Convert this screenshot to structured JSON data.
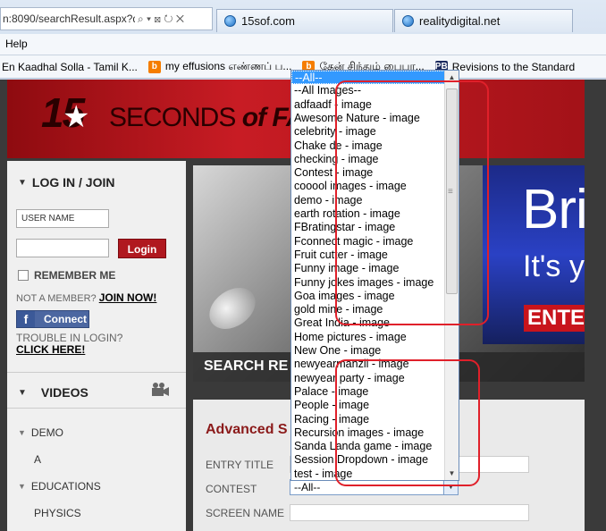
{
  "browser": {
    "address_url": "n:8090/searchResult.aspx?qu",
    "address_controls": "⌕ ▾ ⊠ ↻ ✕",
    "tabs": [
      {
        "label": "15sof.com"
      },
      {
        "label": "realitydigital.net"
      }
    ],
    "menu": "Help",
    "favorites": [
      {
        "label": "En Kaadhal Solla - Tamil K..."
      },
      {
        "label": "my effusions எண்ணப் ப..."
      },
      {
        "label": "தேன் சிந்தும் பைபா..."
      },
      {
        "label": "Revisions to the Standard"
      }
    ]
  },
  "header": {
    "logo_number": "15",
    "logo_text_1": "SECONDS",
    "logo_text_2": "of FA"
  },
  "login": {
    "heading": "LOG IN / JOIN",
    "username_placeholder": "USER NAME",
    "login_button": "Login",
    "remember_label": "REMEMBER ME",
    "not_member": "NOT A MEMBER?",
    "join_now": "JOIN NOW!",
    "fb_connect": "Connect",
    "trouble_text": "TROUBLE IN LOGIN?",
    "click_here": "CLICK HERE!"
  },
  "videos": {
    "heading": "VIDEOS",
    "categories": [
      {
        "label": "DEMO",
        "expanded": true
      },
      {
        "label": "A",
        "child": true
      },
      {
        "label": "EDUCATIONS",
        "expanded": true
      },
      {
        "label": "PHYSICS",
        "child": true
      }
    ]
  },
  "banner": {
    "headline": "Bri",
    "subline": "It's y",
    "enter": "ENTER",
    "search_results": "SEARCH RE"
  },
  "advanced_search": {
    "title": "Advanced S",
    "entry_title_label": "ENTRY TITLE",
    "contest_label": "CONTEST",
    "contest_selected": "--All--",
    "screen_name_label": "SCREEN NAME"
  },
  "dropdown": {
    "selected_index": 0,
    "options": [
      "--All--",
      "--All Images--",
      "adfaadf - image",
      "Awesome Nature - image",
      "celebrity - image",
      "Chake de - image",
      "checking - image",
      "Contest - image",
      "cooool images - image",
      "demo - image",
      "earth rotation - image",
      "FBratingstar - image",
      "Fconnect magic - image",
      "Fruit cutter - image",
      "Funny image - image",
      "Funny jokes images - image",
      "Goa images - image",
      "gold mine - image",
      "Great India - image",
      "Home pictures - image",
      "New One - image",
      "newyearmanzil - image",
      "newyear party - image",
      "Palace - image",
      "People - image",
      "Racing - image",
      "Recursion images - image",
      "Sanda Landa game - image",
      "Session Dropdown - image",
      "test - image"
    ]
  },
  "colors": {
    "accent_red": "#c81c24",
    "selection_blue": "#3399ff",
    "annotation_red": "#e0202a"
  }
}
